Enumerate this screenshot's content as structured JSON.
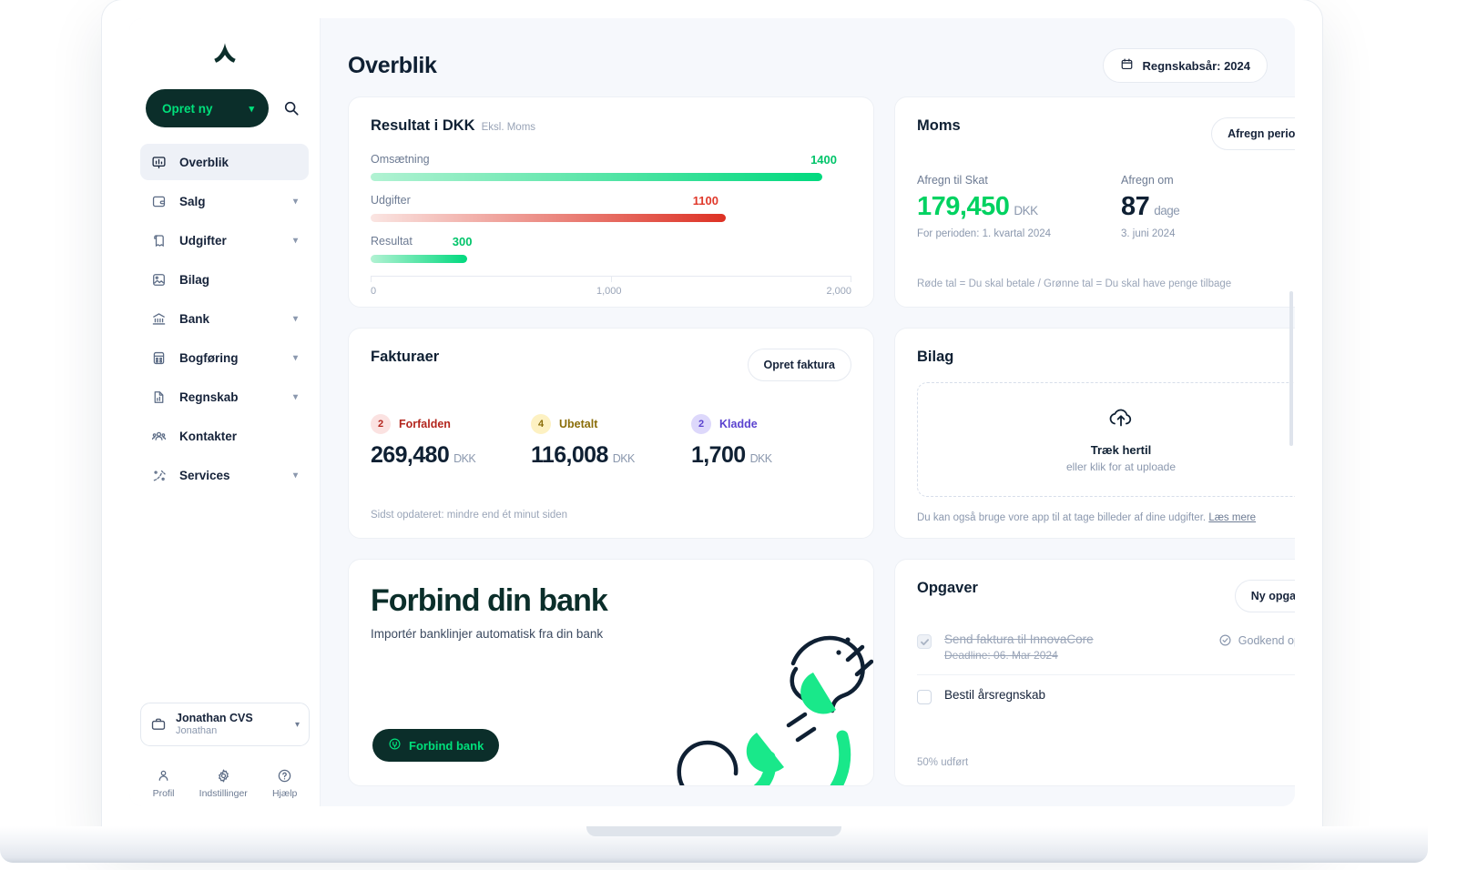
{
  "brand": {
    "accent_green": "#00e07b",
    "dark_green": "#0b2e2a",
    "logo_name": "ageras-logo"
  },
  "sidebar": {
    "create_button": {
      "label": "Opret ny",
      "icon": "chevron-down-icon"
    },
    "search_icon": "search-icon",
    "items": [
      {
        "label": "Overblik",
        "icon": "dashboard-icon",
        "active": true,
        "expandable": false
      },
      {
        "label": "Salg",
        "icon": "sales-icon",
        "active": false,
        "expandable": true
      },
      {
        "label": "Udgifter",
        "icon": "expenses-icon",
        "active": false,
        "expandable": true
      },
      {
        "label": "Bilag",
        "icon": "receipt-icon",
        "active": false,
        "expandable": false
      },
      {
        "label": "Bank",
        "icon": "bank-icon",
        "active": false,
        "expandable": true
      },
      {
        "label": "Bogføring",
        "icon": "ledger-icon",
        "active": false,
        "expandable": true
      },
      {
        "label": "Regnskab",
        "icon": "report-icon",
        "active": false,
        "expandable": true
      },
      {
        "label": "Kontakter",
        "icon": "contacts-icon",
        "active": false,
        "expandable": false
      },
      {
        "label": "Services",
        "icon": "services-icon",
        "active": false,
        "expandable": true
      }
    ],
    "company": {
      "name": "Jonathan CVS",
      "user": "Jonathan",
      "icon": "briefcase-icon",
      "chevron": "chevron-down-icon"
    },
    "footer_actions": [
      {
        "label": "Profil",
        "icon": "person-icon"
      },
      {
        "label": "Indstillinger",
        "icon": "gear-icon"
      },
      {
        "label": "Hjælp",
        "icon": "help-circle-icon"
      }
    ]
  },
  "header": {
    "title": "Overblik",
    "year_button": {
      "label": "Regnskabsår: 2024",
      "icon": "calendar-icon"
    }
  },
  "chart_data": {
    "type": "bar",
    "title": "Resultat i DKK",
    "subtitle": "Eksl. Moms",
    "orientation": "horizontal",
    "categories": [
      "Omsætning",
      "Udgifter",
      "Resultat"
    ],
    "values": [
      1400,
      1100,
      300
    ],
    "value_labels": [
      "1400",
      "1100",
      "300"
    ],
    "colors": [
      "#00d97e",
      "#e0392b",
      "#00d97e"
    ],
    "bar_start_colors": [
      "#aaf0cd",
      "#f9dfdc",
      "#aaf0cd"
    ],
    "xlabel": "",
    "ylabel": "",
    "axis_ticks": [
      "0",
      "1,000",
      "2,000"
    ],
    "xlim": [
      0,
      2000
    ],
    "grid": false,
    "legend": "none"
  },
  "moms": {
    "title": "Moms",
    "button": "Afregn periode",
    "left": {
      "label": "Afregn til Skat",
      "value": "179,450",
      "unit": "DKK",
      "note": "For perioden: 1. kvartal 2024",
      "color": "#00d261"
    },
    "right": {
      "label": "Afregn om",
      "value": "87",
      "unit": "dage",
      "note": "3. juni 2024",
      "color": "#0f2033"
    },
    "footnote": "Røde tal = Du skal betale / Grønne tal = Du skal have penge tilbage"
  },
  "fakturaer": {
    "title": "Fakturaer",
    "button": "Opret faktura",
    "columns": [
      {
        "count": "2",
        "status": "Forfalden",
        "amount": "269,480",
        "unit": "DKK",
        "badge_bg": "#fbe2e1",
        "badge_fg": "#b3261e",
        "status_color": "#b3261e"
      },
      {
        "count": "4",
        "status": "Ubetalt",
        "amount": "116,008",
        "unit": "DKK",
        "badge_bg": "#fdf1c2",
        "badge_fg": "#8a6d09",
        "status_color": "#8a6d09"
      },
      {
        "count": "2",
        "status": "Kladde",
        "amount": "1,700",
        "unit": "DKK",
        "badge_bg": "#ddd8fb",
        "badge_fg": "#5b43cf",
        "status_color": "#5b43cf"
      }
    ],
    "footnote": "Sidst opdateret: mindre end ét minut siden"
  },
  "bilag": {
    "title": "Bilag",
    "dropzone": {
      "icon": "cloud-upload-icon",
      "title": "Træk hertil",
      "subtitle": "eller klik for at uploade"
    },
    "footnote": "Du kan også bruge vore app til at tage billeder af dine udgifter.",
    "footnote_link": "Læs mere"
  },
  "bank_promo": {
    "title": "Forbind din bank",
    "subtitle": "Importér banklinjer automatisk fra din bank",
    "button": {
      "label": "Forbind bank",
      "icon": "plug-icon"
    },
    "illustration": "hands-plug-illustration"
  },
  "opgaver": {
    "title": "Opgaver",
    "button": "Ny opgave",
    "tasks": [
      {
        "name": "Send faktura til InnovaCore",
        "deadline": "Deadline: 06. Mar 2024",
        "done": true,
        "action": "Godkend opgave",
        "action_icon": "check-circle-icon"
      },
      {
        "name": "Bestil årsregnskab",
        "deadline": "",
        "done": false,
        "action": "",
        "action_icon": ""
      }
    ],
    "progress": "50% udført"
  }
}
